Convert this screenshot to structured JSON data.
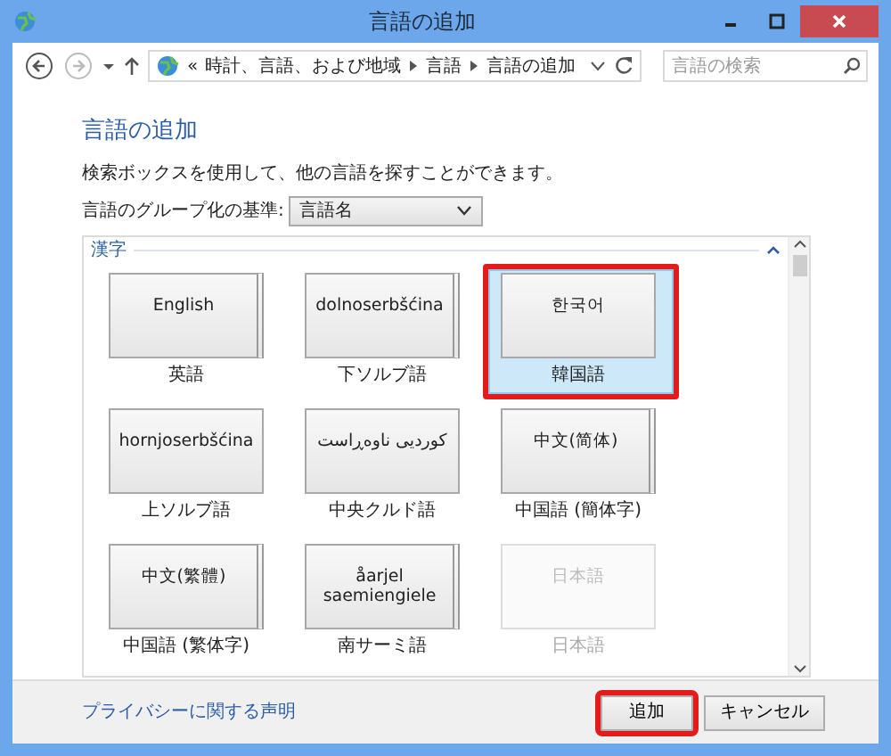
{
  "window": {
    "title": "言語の追加"
  },
  "nav": {
    "overflow": "«",
    "breadcrumb": [
      "時計、言語、および地域",
      "言語",
      "言語の追加"
    ],
    "search": {
      "placeholder": "言語の検索"
    }
  },
  "heading": "言語の追加",
  "description": "検索ボックスを使用して、他の言語を探すことができます。",
  "grouping": {
    "label": "言語のグループ化の基準:",
    "value": "言語名"
  },
  "group": {
    "title": "漢字",
    "tiles": [
      {
        "native": "English",
        "label": "英語",
        "kind": "stacked",
        "selected": false,
        "highlighted": false,
        "disabled": false
      },
      {
        "native": "dolnoserbšćina",
        "label": "下ソルブ語",
        "kind": "stacked",
        "selected": false,
        "highlighted": false,
        "disabled": false
      },
      {
        "native": "한국어",
        "label": "韓国語",
        "kind": "single",
        "selected": true,
        "highlighted": true,
        "disabled": false
      },
      {
        "native": "hornjoserbšćina",
        "label": "上ソルブ語",
        "kind": "single",
        "selected": false,
        "highlighted": false,
        "disabled": false
      },
      {
        "native": "کوردیی ناوەڕاست",
        "label": "中央クルド語",
        "kind": "single",
        "selected": false,
        "highlighted": false,
        "disabled": false
      },
      {
        "native": "中文(简体)",
        "label": "中国語 (簡体字)",
        "kind": "stacked",
        "selected": false,
        "highlighted": false,
        "disabled": false
      },
      {
        "native": "中文(繁體)",
        "label": "中国語 (繁体字)",
        "kind": "stacked",
        "selected": false,
        "highlighted": false,
        "disabled": false
      },
      {
        "native": "åarjel saemiengiele",
        "label": "南サーミ語",
        "kind": "stacked",
        "selected": false,
        "highlighted": false,
        "disabled": false
      },
      {
        "native": "日本語",
        "label": "日本語",
        "kind": "single",
        "selected": false,
        "highlighted": false,
        "disabled": true
      }
    ]
  },
  "footer": {
    "link": "プライバシーに関する声明",
    "buttons": [
      {
        "label": "追加",
        "highlighted": true
      },
      {
        "label": "キャンセル",
        "highlighted": false
      }
    ]
  }
}
